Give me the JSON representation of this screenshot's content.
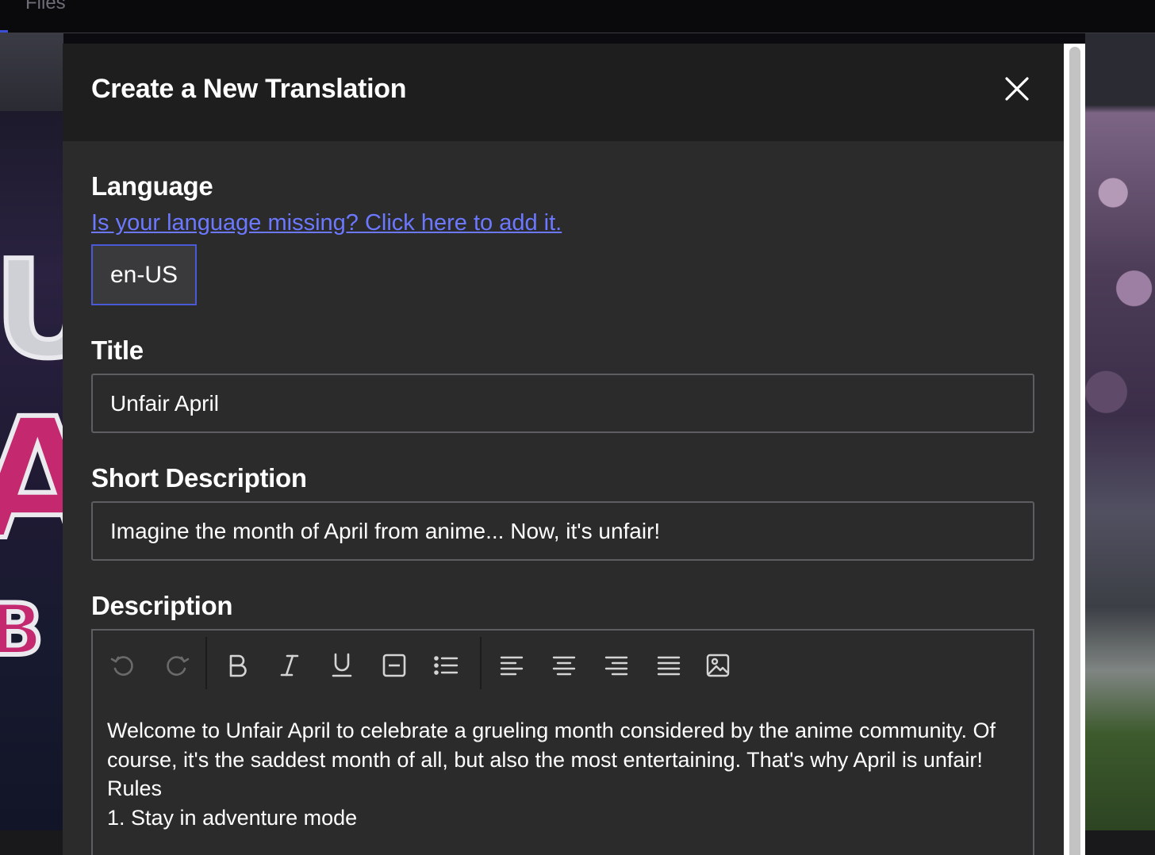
{
  "background": {
    "tab_label": "Files"
  },
  "modal": {
    "title": "Create a New Translation",
    "close_icon": "close-icon",
    "language": {
      "label": "Language",
      "missing_link": "Is your language missing? Click here to add it.",
      "selected_value": "en-US"
    },
    "title_field": {
      "label": "Title",
      "value": "Unfair April"
    },
    "short_description": {
      "label": "Short Description",
      "value": "Imagine the month of April from anime... Now, it's unfair!"
    },
    "description": {
      "label": "Description",
      "toolbar": [
        "undo-icon",
        "redo-icon",
        "bold-icon",
        "italic-icon",
        "underline-icon",
        "strikethrough-box-icon",
        "bullet-list-icon",
        "align-left-icon",
        "align-center-icon",
        "align-right-icon",
        "align-justify-icon",
        "image-icon"
      ],
      "content": {
        "paragraph": "Welcome to Unfair April to celebrate a grueling month considered by the anime community. Of course, it's the saddest month of all, but also the most entertaining. That's why April is unfair!",
        "rules_heading": "Rules",
        "rule_1": "1. Stay in adventure mode"
      }
    }
  },
  "colors": {
    "modal_bg": "#2b2b2b",
    "header_bg": "#1e1e1e",
    "link": "#6b78ff",
    "focus_border": "#4a5ad6",
    "input_border": "#5d5d62"
  }
}
